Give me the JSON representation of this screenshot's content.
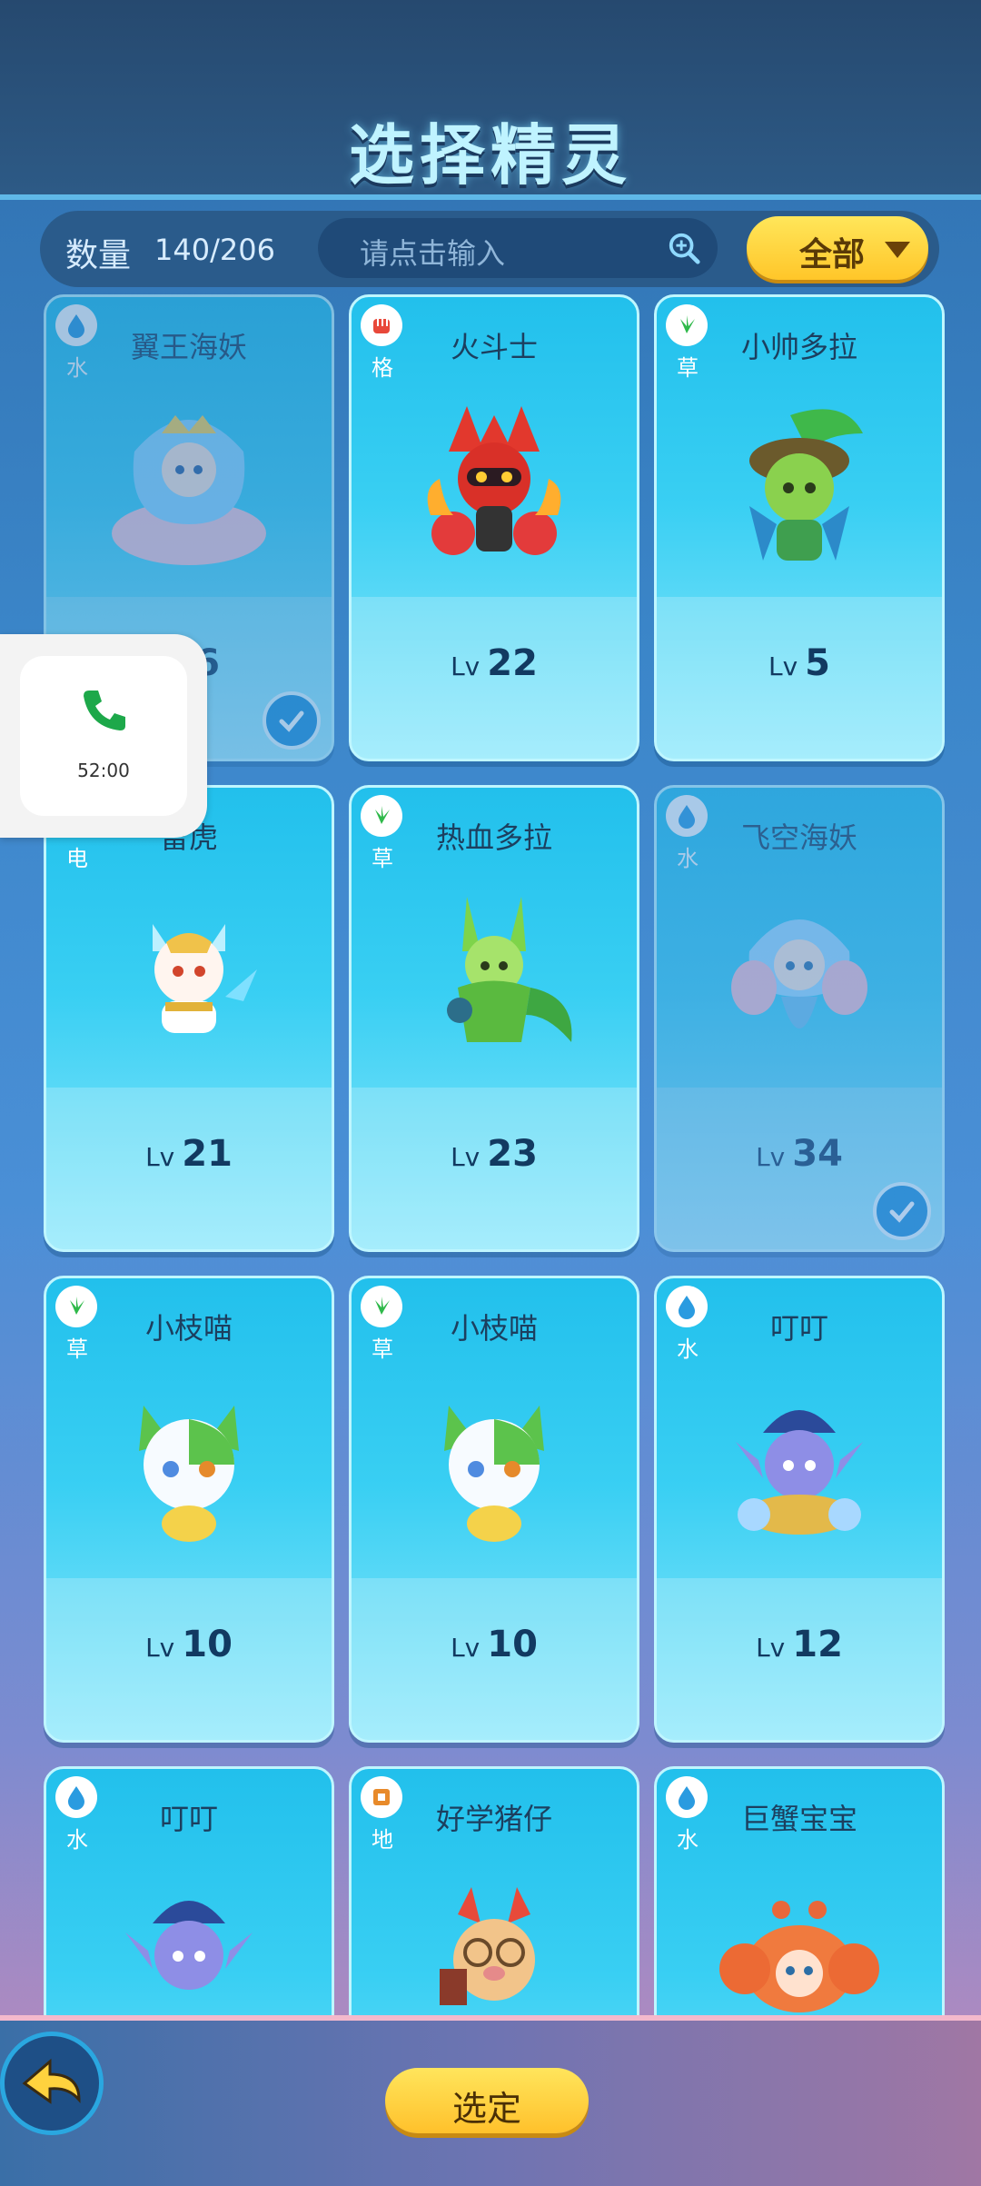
{
  "header": {
    "title": "选择精灵"
  },
  "topbar": {
    "count_label": "数量",
    "count_value": "140/206",
    "search_placeholder": "请点击输入",
    "filter_label": "全部"
  },
  "cards": [
    {
      "name": "翼王海妖",
      "element": "水",
      "level_label": "Lv",
      "level": "6",
      "selected": true,
      "dimmed": true
    },
    {
      "name": "火斗士",
      "element": "格",
      "level_label": "Lv",
      "level": "22",
      "selected": false,
      "dimmed": false
    },
    {
      "name": "小帅多拉",
      "element": "草",
      "level_label": "Lv",
      "level": "5",
      "selected": false,
      "dimmed": false
    },
    {
      "name": "雷虎",
      "element": "电",
      "level_label": "Lv",
      "level": "21",
      "selected": false,
      "dimmed": false
    },
    {
      "name": "热血多拉",
      "element": "草",
      "level_label": "Lv",
      "level": "23",
      "selected": false,
      "dimmed": false
    },
    {
      "name": "飞空海妖",
      "element": "水",
      "level_label": "Lv",
      "level": "34",
      "selected": true,
      "dimmed": true
    },
    {
      "name": "小枝喵",
      "element": "草",
      "level_label": "Lv",
      "level": "10",
      "selected": false,
      "dimmed": false
    },
    {
      "name": "小枝喵",
      "element": "草",
      "level_label": "Lv",
      "level": "10",
      "selected": false,
      "dimmed": false
    },
    {
      "name": "叮叮",
      "element": "水",
      "level_label": "Lv",
      "level": "12",
      "selected": false,
      "dimmed": false
    },
    {
      "name": "叮叮",
      "element": "水",
      "level_label": "",
      "level": "",
      "selected": false,
      "dimmed": false
    },
    {
      "name": "好学猪仔",
      "element": "地",
      "level_label": "",
      "level": "",
      "selected": false,
      "dimmed": false
    },
    {
      "name": "巨蟹宝宝",
      "element": "水",
      "level_label": "",
      "level": "",
      "selected": false,
      "dimmed": false
    }
  ],
  "call_overlay": {
    "time": "52:00",
    "icon": "phone-icon"
  },
  "bottom": {
    "confirm_label": "选定",
    "back_icon": "back-arrow-icon"
  },
  "colors": {
    "card": "#33c9f1",
    "accent": "#ffd23e",
    "header": "#2a527c"
  }
}
